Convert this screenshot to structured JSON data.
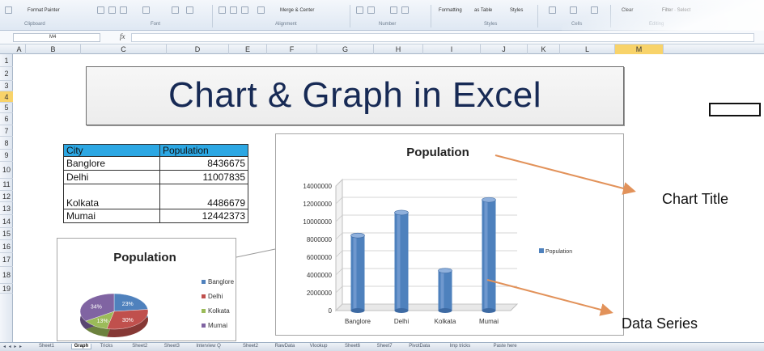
{
  "ribbon": {
    "commands": [
      {
        "id": "format_painter",
        "label": "Format Painter"
      },
      {
        "id": "conditional_formatting",
        "label": "Formatting"
      },
      {
        "id": "format_as_table",
        "label": "as Table"
      },
      {
        "id": "cell_styles",
        "label": "Styles"
      },
      {
        "id": "clear",
        "label": "Clear"
      },
      {
        "id": "filter_select",
        "label": "Filter · Select"
      },
      {
        "id": "merge_center",
        "label": "Merge & Center"
      }
    ],
    "groups": [
      "Clipboard",
      "Font",
      "Alignment",
      "Number",
      "Styles",
      "Cells",
      "Editing"
    ]
  },
  "formula_bar": {
    "name_box": "M4",
    "fx": "fx",
    "content": ""
  },
  "columns": [
    "A",
    "B",
    "C",
    "D",
    "E",
    "F",
    "G",
    "H",
    "I",
    "J",
    "K",
    "L",
    "M"
  ],
  "active_column": "M",
  "rows": [
    "1",
    "2",
    "3",
    "4",
    "5",
    "6",
    "7",
    "8",
    "9",
    "10",
    "11",
    "12",
    "13",
    "14",
    "15",
    "16",
    "17",
    "18",
    "19"
  ],
  "active_row": "4",
  "banner": {
    "title": "Chart & Graph in Excel"
  },
  "table": {
    "headers": [
      "City",
      "Population"
    ],
    "rows": [
      [
        "Banglore",
        "8436675"
      ],
      [
        "Delhi",
        "11007835"
      ],
      [
        "Kolkata",
        "4486679"
      ],
      [
        "Mumai",
        "12442373"
      ]
    ]
  },
  "callouts": {
    "chart_title": "Chart Title",
    "data_series": "Data Series"
  },
  "chart_data": [
    {
      "type": "bar",
      "title": "Population",
      "categories": [
        "Banglore",
        "Delhi",
        "Kolkata",
        "Mumai"
      ],
      "series": [
        {
          "name": "Population",
          "values": [
            8436675,
            11007835,
            4486679,
            12442373
          ]
        }
      ],
      "yticks": [
        "0",
        "2000000",
        "4000000",
        "6000000",
        "8000000",
        "10000000",
        "12000000",
        "14000000"
      ],
      "ylim": [
        0,
        14000000
      ],
      "grid": true,
      "legend": "right",
      "style": "3d-cylinder",
      "color": "#4e81bd"
    },
    {
      "type": "pie",
      "title": "Population",
      "categories": [
        "Banglore",
        "Delhi",
        "Kolkata",
        "Mumai"
      ],
      "values": [
        8436675,
        11007835,
        4486679,
        12442373
      ],
      "slice_labels": [
        "23%",
        "30%",
        "13%",
        "34%"
      ],
      "colors": [
        "#4f81bd",
        "#c0504d",
        "#9bbb59",
        "#8064a2"
      ],
      "legend": "right",
      "style": "3d"
    }
  ],
  "sheet_tabs": [
    "Sheet1",
    "Graph",
    "Tricks",
    "Sheet2",
    "Sheet3",
    "Interview Q",
    "Sheet2",
    "RawData",
    "Vlookup",
    "Sheet6",
    "Sheet7",
    "PivotData",
    "Imp tricks",
    "Paste here"
  ],
  "active_tab": "Graph"
}
